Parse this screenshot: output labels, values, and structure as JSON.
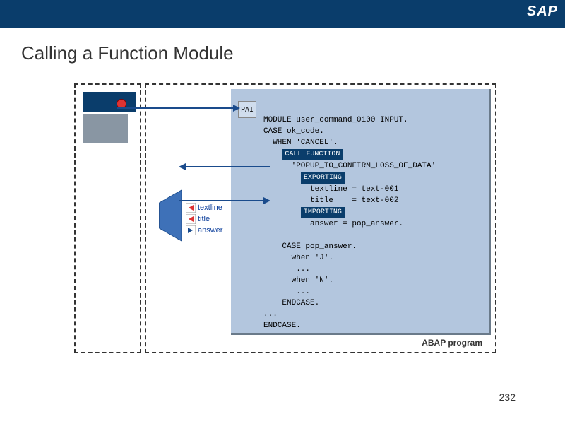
{
  "header": {
    "logo": "SAP"
  },
  "title": "Calling a Function Module",
  "pai_label": "PAI",
  "params": {
    "textline": "textline",
    "title": "title",
    "answer": "answer"
  },
  "code": {
    "l1": "MODULE user_command_0100 INPUT.",
    "l2": "CASE ok_code.",
    "l3": "  WHEN 'CANCEL'.",
    "kw_call": "CALL FUNCTION",
    "l5": "      'POPUP_TO_CONFIRM_LOSS_OF_DATA'",
    "kw_exp": "EXPORTING",
    "l7": "          textline = text-001",
    "l8": "          title    = text-002",
    "kw_imp": "IMPORTING",
    "l10": "          answer = pop_answer.",
    "l11": "",
    "l12": "    CASE pop_answer.",
    "l13": "      when 'J'.",
    "l14": "       ...",
    "l15": "      when 'N'.",
    "l16": "       ...",
    "l17": "    ENDCASE.",
    "l18": "...",
    "l19": "ENDCASE."
  },
  "abap_program": "ABAP program",
  "page_number": "232"
}
